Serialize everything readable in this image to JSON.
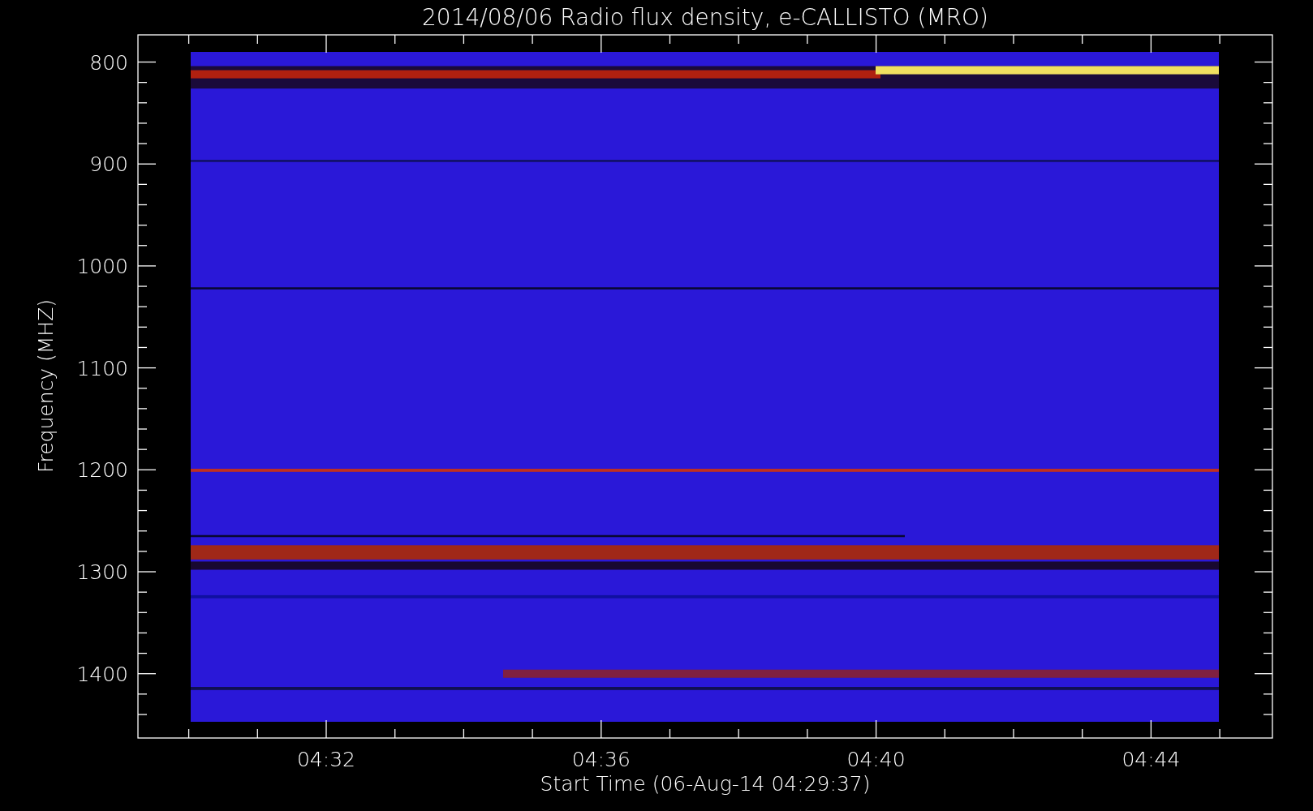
{
  "plot": {
    "title": "2014/08/06  Radio flux density, e-CALLISTO (MRO)",
    "ylabel": "Frequency (MHZ)",
    "xlabel": "Start Time (06-Aug-14 04:29:37)",
    "y_tick_labels": [
      "800",
      "900",
      "1000",
      "1100",
      "1200",
      "1300",
      "1400"
    ],
    "x_tick_labels": [
      "04:32",
      "04:36",
      "04:40",
      "04:44"
    ]
  }
}
